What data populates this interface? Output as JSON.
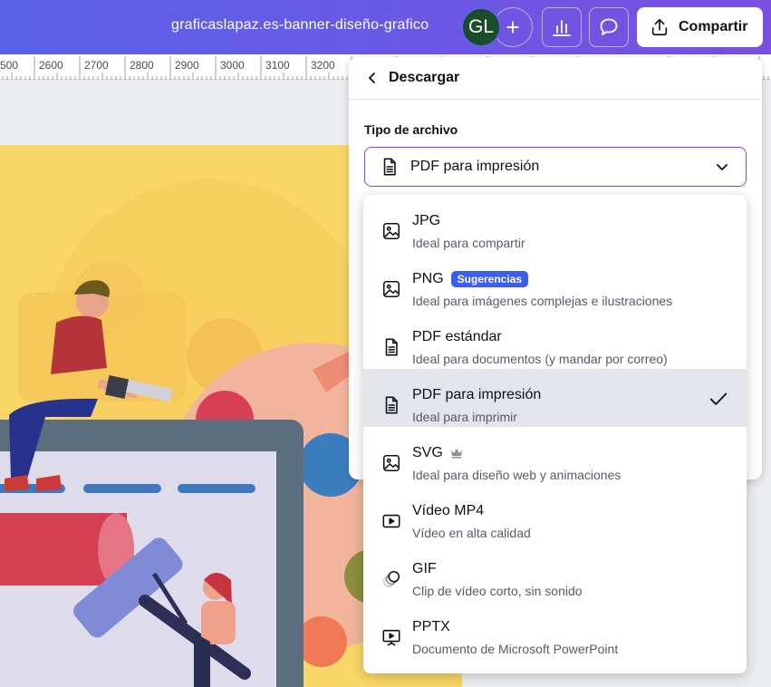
{
  "topbar": {
    "doc_title": "graficaslapaz.es-banner-diseño-grafico",
    "avatar_initials": "GL",
    "add_symbol": "+",
    "share_label": "Compartir"
  },
  "ruler": {
    "ticks": [
      "500",
      "2600",
      "2700",
      "2800",
      "2900",
      "3000",
      "3100",
      "3200"
    ]
  },
  "download_panel": {
    "title": "Descargar",
    "file_type_label": "Tipo de archivo",
    "selected_value": "PDF para impresión"
  },
  "file_types": [
    {
      "name": "JPG",
      "desc": "Ideal para compartir",
      "icon": "image-icon"
    },
    {
      "name": "PNG",
      "badge": "Sugerencias",
      "desc": "Ideal para imágenes complejas e ilustraciones",
      "icon": "image-icon"
    },
    {
      "name": "PDF estándar",
      "desc": "Ideal para documentos (y mandar por correo)",
      "icon": "document-icon"
    },
    {
      "name": "PDF para impresión",
      "desc": "Ideal para imprimir",
      "icon": "document-icon",
      "selected": true
    },
    {
      "name": "SVG",
      "desc": "Ideal para diseño web y animaciones",
      "icon": "image-icon",
      "premium": "crown-icon"
    },
    {
      "name": "Vídeo MP4",
      "desc": "Vídeo en alta calidad",
      "icon": "video-icon"
    },
    {
      "name": "GIF",
      "desc": "Clip de vídeo corto, sin sonido",
      "icon": "gif-icon"
    },
    {
      "name": "PPTX",
      "desc": "Documento de Microsoft PowerPoint",
      "icon": "presentation-icon"
    }
  ],
  "colors": {
    "topbar_start": "#5a63e6",
    "topbar_end": "#7a4ee0",
    "select_border": "#8b3dff",
    "badge": "#3a5df0",
    "canvas_yellow": "#fad667"
  }
}
